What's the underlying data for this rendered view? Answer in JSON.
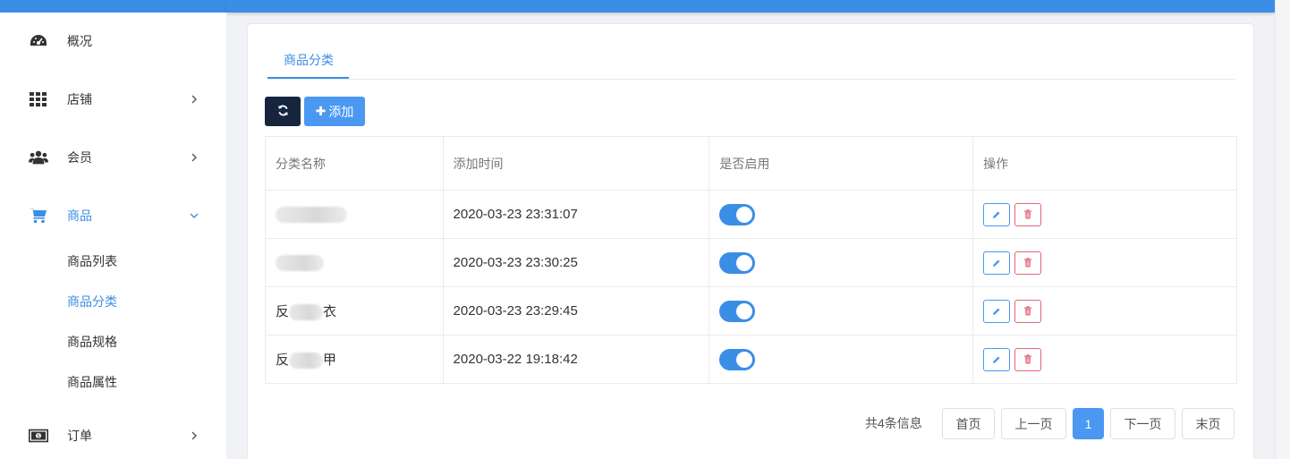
{
  "sidebar": {
    "items": [
      {
        "label": "概况",
        "icon": "dashboard-icon"
      },
      {
        "label": "店铺",
        "icon": "grid-icon"
      },
      {
        "label": "会员",
        "icon": "users-icon"
      },
      {
        "label": "商品",
        "icon": "cart-icon"
      },
      {
        "label": "订单",
        "icon": "money-icon"
      }
    ],
    "subitems": [
      "商品列表",
      "商品分类",
      "商品规格",
      "商品属性"
    ]
  },
  "main": {
    "tab": "商品分类",
    "add_label": "添加",
    "table": {
      "headers": [
        "分类名称",
        "添加时间",
        "是否启用",
        "操作"
      ],
      "rows": [
        {
          "name": "",
          "time": "2020-03-23 23:31:07",
          "enabled": true
        },
        {
          "name": "",
          "time": "2020-03-23 23:30:25",
          "enabled": true
        },
        {
          "name_prefix": "反",
          "name_suffix": "衣",
          "time": "2020-03-23 23:29:45",
          "enabled": true
        },
        {
          "name_prefix": "反",
          "name_suffix": "甲",
          "time": "2020-03-22 19:18:42",
          "enabled": true
        }
      ]
    },
    "pagination": {
      "total": "共4条信息",
      "first": "首页",
      "prev": "上一页",
      "current": "1",
      "next": "下一页",
      "last": "末页"
    }
  },
  "colors": {
    "accent": "#3a8ee6",
    "dark_button": "#16253d",
    "danger": "#e8637d"
  }
}
